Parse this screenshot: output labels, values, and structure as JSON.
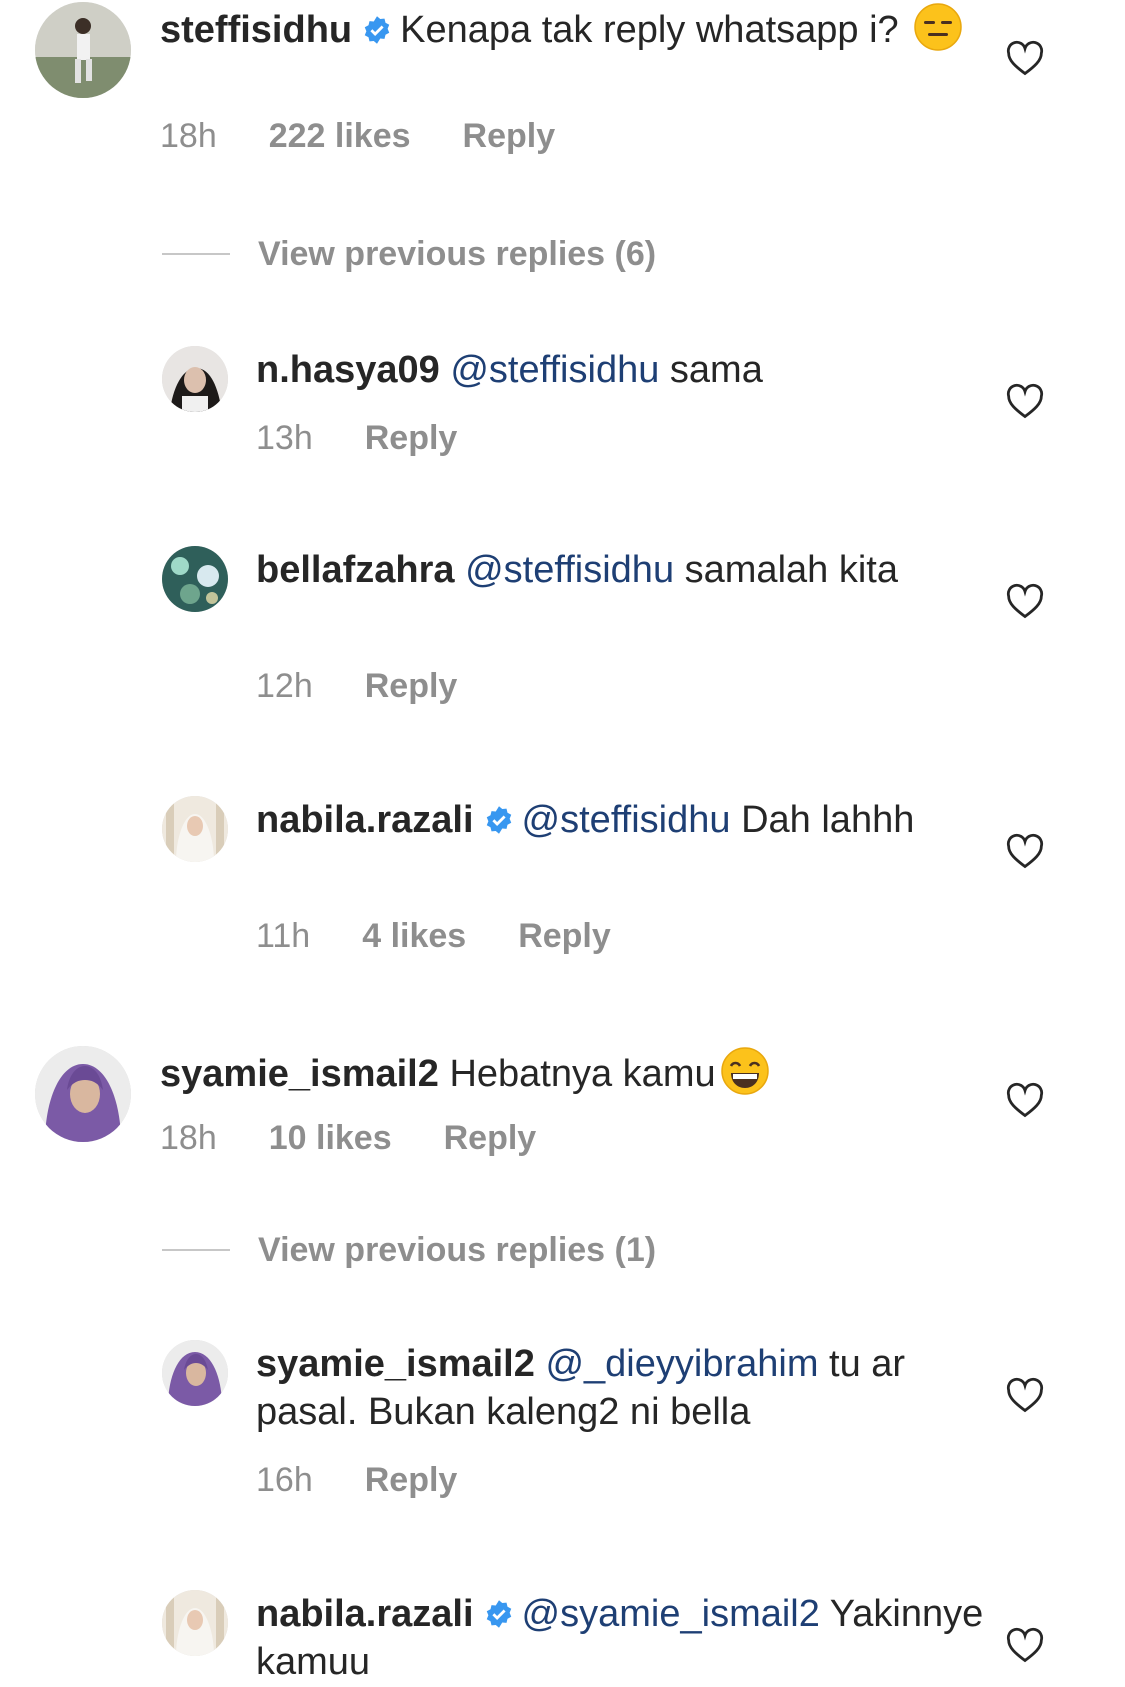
{
  "comments": [
    {
      "username": "steffisidhu",
      "verified": true,
      "text": "Kenapa tak reply whatsapp i?",
      "emoji": "expressionless-face",
      "time": "18h",
      "likes": "222 likes",
      "reply": "Reply",
      "view_replies": "View previous replies (6)"
    },
    {
      "username": "n.hasya09",
      "mention": "@steffisidhu",
      "text": "sama",
      "time": "13h",
      "reply": "Reply"
    },
    {
      "username": "bellafzahra",
      "mention": "@steffisidhu",
      "text": "samalah kita",
      "time": "12h",
      "reply": "Reply"
    },
    {
      "username": "nabila.razali",
      "verified": true,
      "mention": "@steffisidhu",
      "text": "Dah lahhh",
      "time": "11h",
      "likes": "4 likes",
      "reply": "Reply"
    },
    {
      "username": "syamie_ismail2",
      "text": "Hebatnya kamu",
      "emoji": "grinning-face",
      "time": "18h",
      "likes": "10 likes",
      "reply": "Reply",
      "view_replies": "View previous replies (1)"
    },
    {
      "username": "syamie_ismail2",
      "mention": "@_dieyyibrahim",
      "text": "tu ar pasal. Bukan kaleng2 ni bella",
      "time": "16h",
      "reply": "Reply"
    },
    {
      "username": "nabila.razali",
      "verified": true,
      "mention": "@syamie_ismail2",
      "text": "Yakinnye kamuu"
    }
  ],
  "colors": {
    "mention": "#1e3f74",
    "verified": "#3897f0",
    "meta": "#8e8e8e"
  },
  "icons": [
    "heart-icon",
    "verified-badge-icon"
  ]
}
